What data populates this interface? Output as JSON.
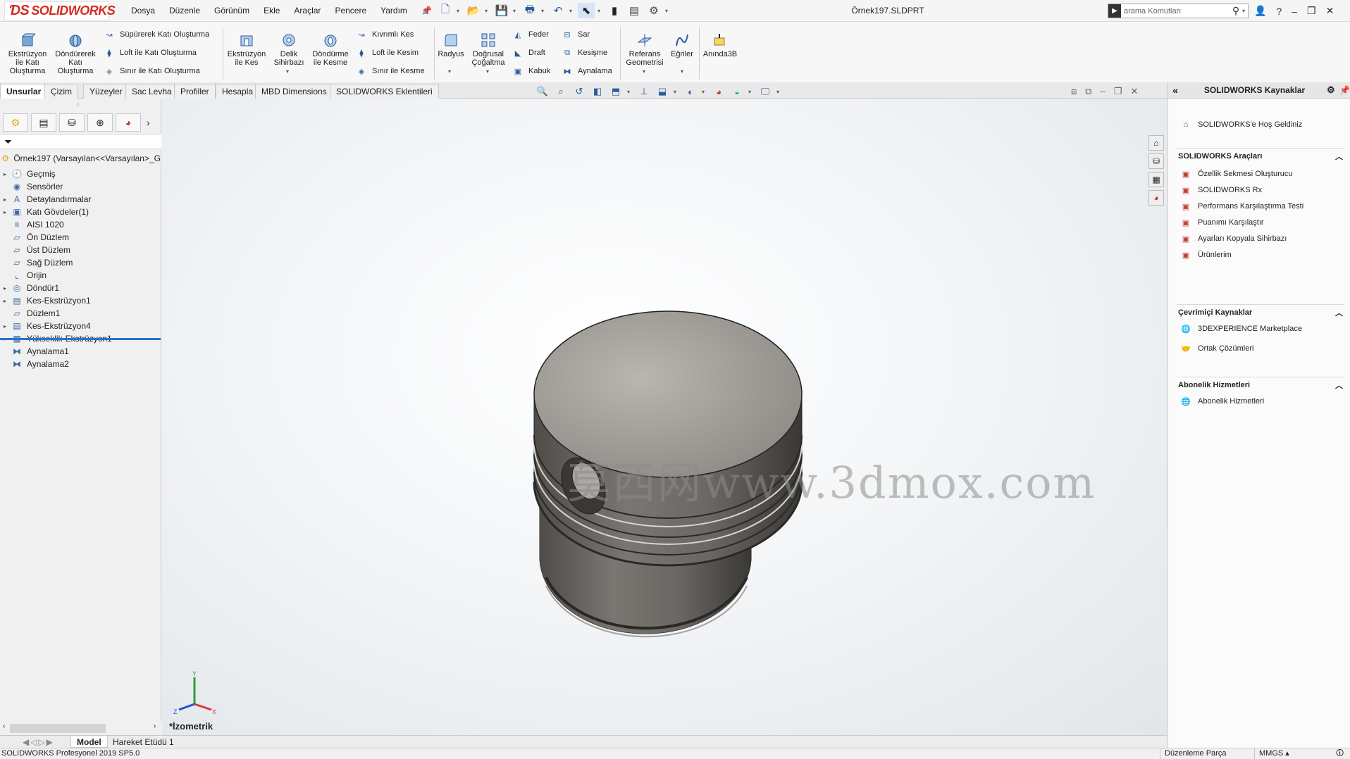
{
  "app": {
    "logo_text": "SOLIDWORKS",
    "doc_title": "Örnek197.SLDPRT",
    "brand_color": "#d52b1e"
  },
  "menu": [
    "Dosya",
    "Düzenle",
    "Görünüm",
    "Ekle",
    "Araçlar",
    "Pencere",
    "Yardım"
  ],
  "search": {
    "placeholder": "arama Komutları"
  },
  "ribbon": {
    "extrude_boss": "Ekstrüzyon ile Katı Oluşturma",
    "revolve_boss": "Döndürerek Katı Oluşturma",
    "swept_boss": "Süpürerek Katı Oluşturma",
    "loft_boss": "Loft ile Katı Oluşturma",
    "boundary_boss": "Sınır ile Katı Oluşturma",
    "extrude_cut": "Ekstrüzyon ile Kes",
    "hole_wizard": "Delik Sihirbazı",
    "revolve_cut": "Döndürme ile Kesme",
    "swept_cut": "Kıvrımlı Kes",
    "loft_cut": "Loft ile Kesim",
    "boundary_cut": "Sınır ile Kesme",
    "fillet": "Radyus",
    "linear_pattern": "Doğrusal Çoğaltma",
    "rib": "Feder",
    "draft": "Draft",
    "shell": "Kabuk",
    "wrap": "Sar",
    "intersect": "Kesişme",
    "mirror": "Aynalama",
    "ref_geometry": "Referans Geometrisi",
    "curves": "Eğriler",
    "instant3d": "Anında3B"
  },
  "tabs": [
    "Unsurlar",
    "Çizim",
    "Yüzeyler",
    "Sac Levha",
    "Profiller",
    "Hesapla",
    "MBD Dimensions",
    "SOLIDWORKS Eklentileri"
  ],
  "tree": {
    "root": "Örnek197  (Varsayılan<<Varsayılan>_G",
    "items": [
      {
        "label": "Geçmiş",
        "icon": "history-icon"
      },
      {
        "label": "Sensörler",
        "icon": "sensor-icon"
      },
      {
        "label": "Detaylandırmalar",
        "icon": "annotation-icon"
      },
      {
        "label": "Katı Gövdeler(1)",
        "icon": "solid-bodies-icon"
      },
      {
        "label": "AISI 1020",
        "icon": "material-icon"
      },
      {
        "label": "Ön Düzlem",
        "icon": "plane-icon"
      },
      {
        "label": "Üst Düzlem",
        "icon": "plane-icon"
      },
      {
        "label": "Sağ Düzlem",
        "icon": "plane-icon"
      },
      {
        "label": "Orijin",
        "icon": "origin-icon"
      },
      {
        "label": "Döndür1",
        "icon": "revolve-feature-icon"
      },
      {
        "label": "Kes-Ekstrüzyon1",
        "icon": "cut-extrude-icon"
      },
      {
        "label": "Düzlem1",
        "icon": "plane-icon"
      },
      {
        "label": "Kes-Ekstrüzyon4",
        "icon": "cut-extrude-icon"
      },
      {
        "label": "Yükseklik-Ekstrüzyon1",
        "icon": "boss-extrude-icon"
      },
      {
        "label": "Aynalama1",
        "icon": "mirror-feature-icon"
      },
      {
        "label": "Aynalama2",
        "icon": "mirror-feature-icon"
      }
    ]
  },
  "viewport": {
    "watermark": "莫西网www.3dmox.com",
    "view_label": "*İzometrik"
  },
  "bottom_tabs": [
    "Model",
    "Hareket Etüdü 1"
  ],
  "status": {
    "version": "SOLIDWORKS Profesyonel 2019 SP5.0",
    "mode": "Düzenleme Parça",
    "units": "MMGS"
  },
  "task_pane": {
    "title": "SOLIDWORKS Kaynaklar",
    "welcome": "SOLIDWORKS'e Hoş Geldiniz",
    "tools_title": "SOLIDWORKS Araçları",
    "tools": [
      "Özellik Sekmesi Oluşturucu",
      "SOLIDWORKS Rx",
      "Performans Karşılaştırma Testi",
      "Puanımı Karşılaştır",
      "Ayarları Kopyala Sihirbazı",
      "Ürünlerim"
    ],
    "online_title": "Çevrimiçi Kaynaklar",
    "online": [
      "3DEXPERIENCE Marketplace",
      "Ortak Çözümleri"
    ],
    "sub_title": "Abonelik Hizmetleri",
    "sub": [
      "Abonelik Hizmetleri"
    ]
  }
}
